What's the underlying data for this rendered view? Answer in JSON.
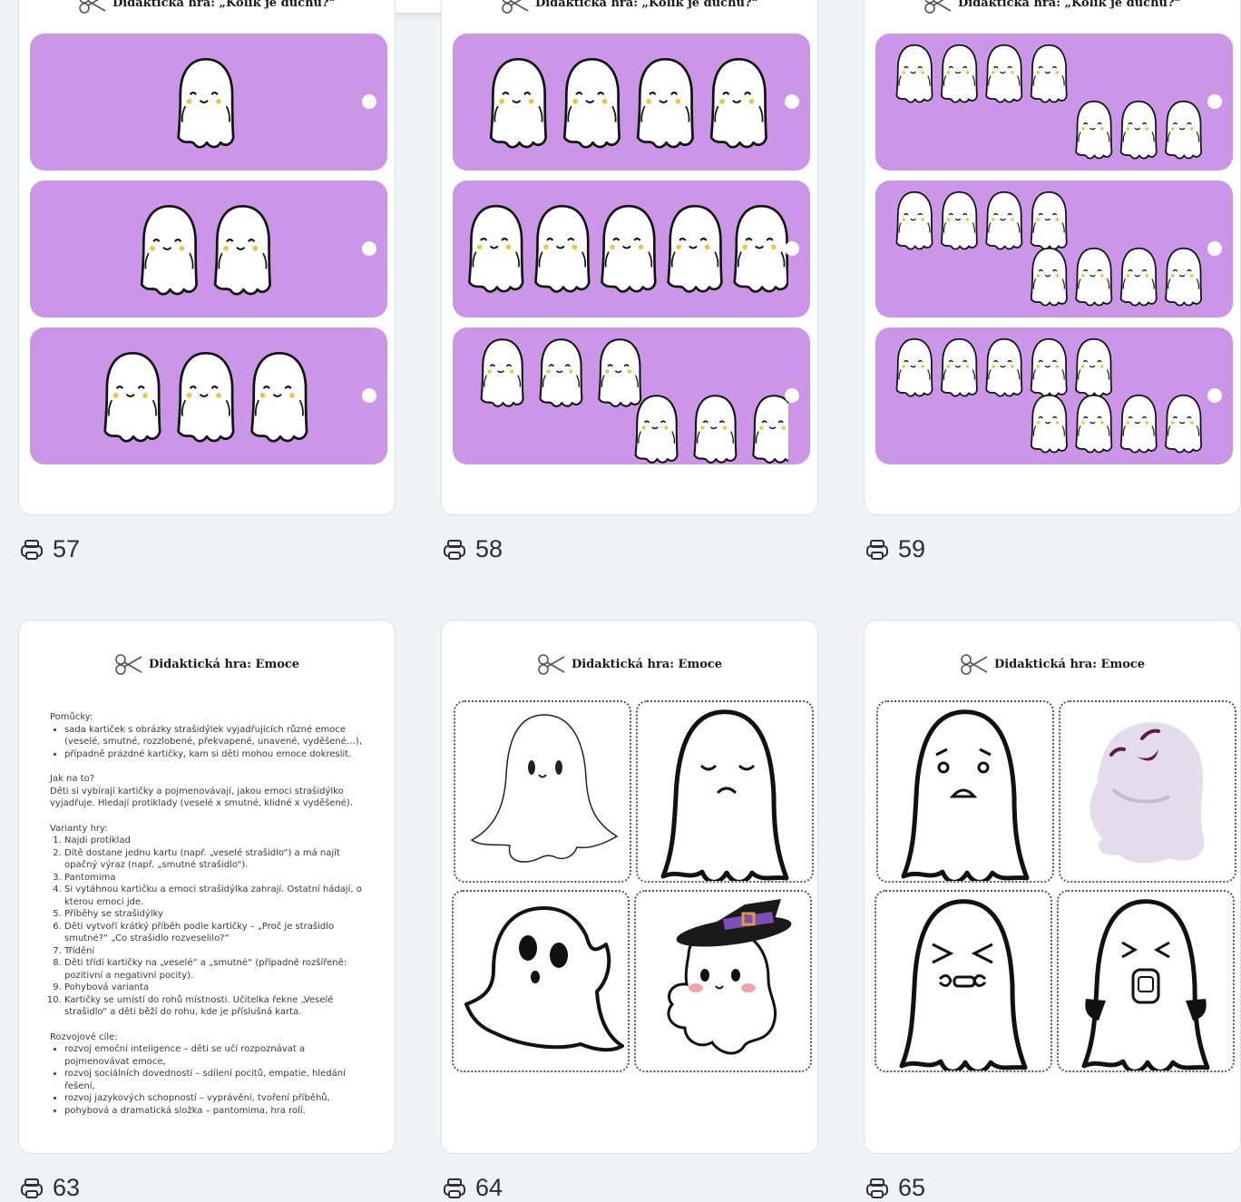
{
  "strip_color": "#cc96e8",
  "cards": [
    {
      "title": "Didaktická hra: „Kolik je duchů?“",
      "strips": [
        1,
        2,
        3
      ]
    },
    {
      "title": "Didaktická hra: „Kolik je duchů?“",
      "strips": [
        4,
        5,
        6
      ]
    },
    {
      "title": "Didaktická hra: „Kolik je duchů?“",
      "strips": [
        7,
        8,
        9
      ]
    },
    {
      "title": "Didaktická hra: Emoce"
    },
    {
      "title": "Didaktická hra: Emoce",
      "tiles": [
        "ghost-drape-smile",
        "ghost-sad-sleepy",
        "ghost-surprised",
        "ghost-witch-hat"
      ]
    },
    {
      "title": "Didaktická hra: Emoce",
      "tiles": [
        "ghost-worried",
        "ghost-laughing",
        "ghost-angry",
        "ghost-crying"
      ]
    }
  ],
  "counts": [
    "57",
    "58",
    "59",
    "63",
    "64",
    "65"
  ],
  "doc": {
    "pomucky_heading": "Pomůcky:",
    "pomucky": [
      "sada kartiček s obrázky strašidýlek vyjadřujících různé emoce (veselé, smutné, rozzlobené, překvapené, unavené, vyděšené…),",
      "případně prázdné kartičky, kam si děti mohou emoce dokreslit."
    ],
    "jak_heading": "Jak na to?",
    "jak_text": "Děti si vybírají kartičky a pojmenovávají, jakou emoci strašidýlko vyjadřuje. Hledají protiklady (veselé x smutné, klidné x vyděšené).",
    "varianty_heading": "Varianty hry:",
    "varianty": [
      "Najdi protiklad",
      "Dítě dostane jednu kartu (např. „veselé strašidlo“) a má najít opačný výraz (např. „smutné strašidlo“).",
      "Pantomima",
      "Si vytáhnou kartičku a emoci strašidýlka zahrají. Ostatní hádají, o kterou emoci jde.",
      "Příběhy se strašidýlky",
      "Děti vytvoří krátký příběh podle kartičky – „Proč je strašidlo smutné?“ „Co strašidlo rozveselilo?“",
      "Třídění",
      "Děti třídí kartičky na „veselé“ a „smutné“ (případně rozšířeně: pozitivní a negativní pocity).",
      "Pohybová varianta",
      "Kartičky se umístí do rohů místnosti. Učitelka řekne „Veselé strašidlo“ a děti běží do rohu, kde je příslušná karta."
    ],
    "cile_heading": "Rozvojové cíle:",
    "cile": [
      "rozvoj emoční inteligence – děti se učí rozpoznávat a pojmenovávat emoce,",
      "rozvoj sociálních dovedností – sdílení pocitů, empatie, hledání řešení,",
      "rozvoj jazykových schopností – vyprávění, tvoření příběhů,",
      "pohybová a dramatická složka – pantomima, hra rolí."
    ]
  }
}
